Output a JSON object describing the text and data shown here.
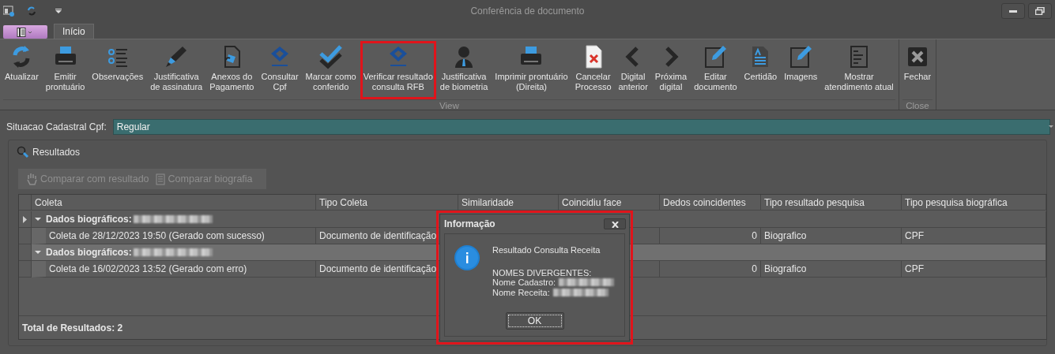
{
  "window": {
    "title": "Conferência de documento"
  },
  "tabs": [
    {
      "label": "Início",
      "selected": true
    }
  ],
  "ribbon": {
    "groups": [
      {
        "label": "View",
        "buttons": [
          {
            "label": "Atualizar",
            "kind": "refresh",
            "highlighted": false
          },
          {
            "label": "Emitir\nprontuário",
            "kind": "printer",
            "highlighted": false
          },
          {
            "label": "Observações",
            "kind": "list",
            "highlighted": false
          },
          {
            "label": "Justificativa\nde assinatura",
            "kind": "pen",
            "highlighted": false
          },
          {
            "label": "Anexos do\nPagamento",
            "kind": "attachment",
            "highlighted": false
          },
          {
            "label": "Consultar\nCpf",
            "kind": "emblem",
            "highlighted": false
          },
          {
            "label": "Marcar como\nconferido",
            "kind": "check",
            "highlighted": false
          },
          {
            "label": "Verificar resultado\nconsulta RFB",
            "kind": "emblem",
            "highlighted": true
          },
          {
            "label": "Justificativa\nde biometria",
            "kind": "person",
            "highlighted": false
          },
          {
            "label": "Imprimir prontuário\n(Direita)",
            "kind": "printer",
            "highlighted": false
          },
          {
            "label": "Cancelar\nProcesso",
            "kind": "cancel",
            "highlighted": false
          },
          {
            "label": "Digital\nanterior",
            "kind": "prev",
            "highlighted": false
          },
          {
            "label": "Próxima\ndigital",
            "kind": "next",
            "highlighted": false
          },
          {
            "label": "Editar\ndocumento",
            "kind": "edit",
            "highlighted": false
          },
          {
            "label": "Certidão",
            "kind": "textdoc",
            "highlighted": false
          },
          {
            "label": "Imagens",
            "kind": "edit",
            "highlighted": false
          },
          {
            "label": "Mostrar\natendimento atual",
            "kind": "doc",
            "highlighted": false
          }
        ]
      },
      {
        "label": "Close",
        "buttons": [
          {
            "label": "Fechar",
            "kind": "close",
            "highlighted": false
          }
        ]
      }
    ]
  },
  "status_field": {
    "label": "Situacao Cadastral Cpf:",
    "value": "Regular"
  },
  "results": {
    "title": "Resultados",
    "toolbar": [
      {
        "label": "Comparar com resultado",
        "kind": "hand",
        "disabled": true
      },
      {
        "label": "Comparar biografia",
        "kind": "doc",
        "disabled": true
      }
    ],
    "columns": [
      "Coleta",
      "Tipo Coleta",
      "Similaridade",
      "Coincidiu face",
      "Dedos coincidentes",
      "Tipo resultado pesquisa",
      "Tipo pesquisa biográfica"
    ],
    "groups": [
      {
        "label": "Dados biográficos:",
        "expanded": true,
        "selected": false,
        "current": true,
        "rows": [
          {
            "coleta": "Coleta de 28/12/2023 19:50 (Gerado com sucesso)",
            "tipo_coleta": "Documento de identificação",
            "dedos": "0",
            "tipo_resultado": "Biografico",
            "tipo_pesquisa": "CPF"
          }
        ]
      },
      {
        "label": "Dados biográficos:",
        "expanded": true,
        "selected": true,
        "current": false,
        "rows": [
          {
            "coleta": "Coleta de 16/02/2023 13:52 (Gerado com erro)",
            "tipo_coleta": "Documento de identificação",
            "dedos": "0",
            "tipo_resultado": "Biografico",
            "tipo_pesquisa": "CPF"
          }
        ]
      }
    ],
    "total": "Total de Resultados: 2"
  },
  "dialog": {
    "title": "Informação",
    "highlighted": true,
    "heading": "Resultado Consulta Receita",
    "lines": [
      {
        "text": "NOMES DIVERGENTES:",
        "redacted": false
      },
      {
        "text": "Nome Cadastro:",
        "redacted": true
      },
      {
        "text": "Nome Receita:",
        "redacted": true
      }
    ],
    "button": "OK"
  }
}
